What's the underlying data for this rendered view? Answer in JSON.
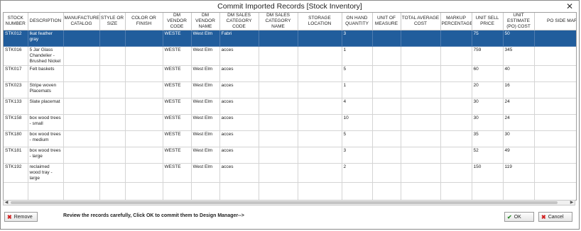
{
  "window": {
    "title": "Commit Imported Records [Stock Inventory]"
  },
  "grid": {
    "columns": [
      "STOCK NUMBER",
      "DESCRIPTION",
      "MANUFACTURER CATALOG",
      "STYLE OR SIZE",
      "COLOR OR FINISH",
      "DM VENDOR CODE",
      "DM VENDOR NAME",
      "DM SALES CATEGORY CODE",
      "DM SALES CATEGORY NAME",
      "STORAGE LOCATION",
      "ON HAND QUANTITY",
      "UNIT OF MEASURE",
      "TOTAL AVERAGE COST",
      "MARKUP PERCENTAGE",
      "UNIT SELL PRICE",
      "UNIT ESTIMATE (PO) COST",
      "PO SIDE MARK"
    ],
    "rows": [
      [
        "STK012",
        "Ikat feather gray",
        "",
        "",
        "",
        "WESTE",
        "West Elm",
        "Fabri",
        "",
        "",
        "3",
        "",
        "",
        "",
        "75",
        "50",
        ""
      ],
      [
        "STK016",
        "5 Jar Glass Chandelier - Brushed Nickel",
        "",
        "",
        "",
        "WESTE",
        "West Elm",
        "acces",
        "",
        "",
        "1",
        "",
        "",
        "",
        "759",
        "345",
        ""
      ],
      [
        "STK017",
        "Felt baskets",
        "",
        "",
        "",
        "WESTE",
        "West Elm",
        "acces",
        "",
        "",
        "5",
        "",
        "",
        "",
        "60",
        "40",
        ""
      ],
      [
        "STK023",
        "Stripe woven Placemats",
        "",
        "",
        "",
        "WESTE",
        "West Elm",
        "acces",
        "",
        "",
        "1",
        "",
        "",
        "",
        "20",
        "16",
        ""
      ],
      [
        "STK133",
        "Slate placemat",
        "",
        "",
        "",
        "WESTE",
        "West Elm",
        "acces",
        "",
        "",
        "4",
        "",
        "",
        "",
        "30",
        "24",
        ""
      ],
      [
        "STK158",
        "box wood trees - small",
        "",
        "",
        "",
        "WESTE",
        "West Elm",
        "acces",
        "",
        "",
        "10",
        "",
        "",
        "",
        "30",
        "24",
        ""
      ],
      [
        "STK180",
        "box wood trees - medium",
        "",
        "",
        "",
        "WESTE",
        "West Elm",
        "acces",
        "",
        "",
        "5",
        "",
        "",
        "",
        "35",
        "30",
        ""
      ],
      [
        "STK181",
        "box wood trees - large",
        "",
        "",
        "",
        "WESTE",
        "West Elm",
        "acces",
        "",
        "",
        "3",
        "",
        "",
        "",
        "52",
        "49",
        ""
      ],
      [
        "STK192",
        "reclaimed wood tray - large",
        "",
        "",
        "",
        "WESTE",
        "West Elm",
        "acces",
        "",
        "",
        "2",
        "",
        "",
        "",
        "150",
        "119",
        ""
      ]
    ]
  },
  "footer": {
    "remove_label": "Remove",
    "message": "Review the records carefully, Click OK to commit them to Design Manager-->",
    "ok_label": "OK",
    "cancel_label": "Cancel"
  },
  "colors": {
    "selected_row": "#215d9c",
    "ok_icon": "#2e8b2e",
    "cancel_icon": "#d02020",
    "remove_icon": "#d02020"
  },
  "icons": {
    "close": "close-icon",
    "remove": "red-x-icon",
    "ok": "check-icon",
    "cancel": "red-x-icon"
  }
}
